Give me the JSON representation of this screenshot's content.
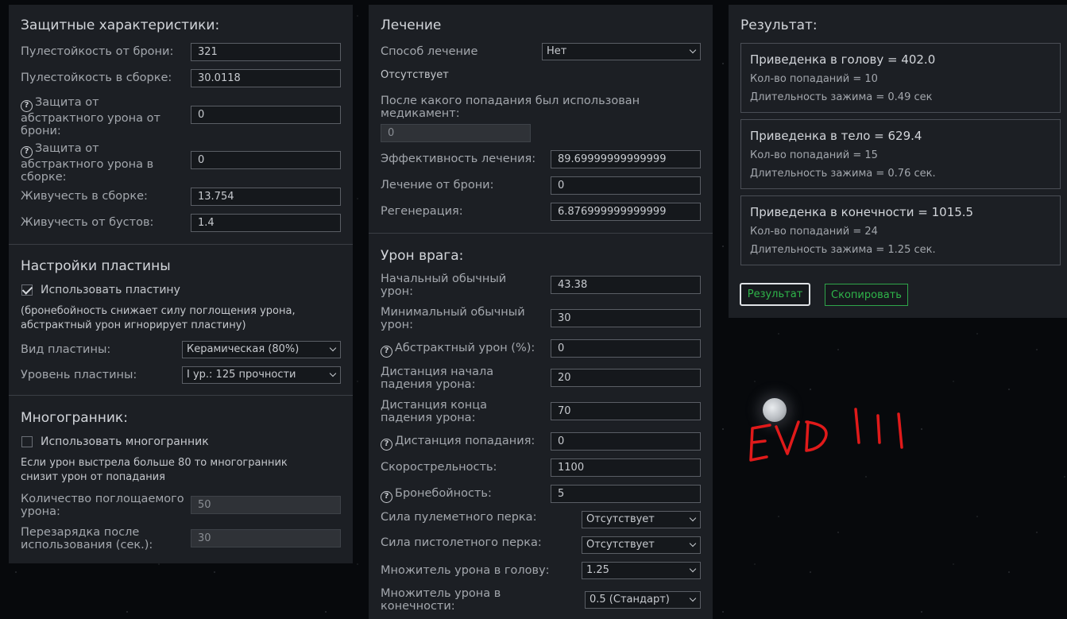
{
  "protective": {
    "title": "Защитные характеристики:",
    "armor_bullet_res_label": "Пулестойкость от брони:",
    "armor_bullet_res": "321",
    "build_bullet_res_label": "Пулестойкость в сборке:",
    "build_bullet_res": "30.0118",
    "armor_abstract_label": "Защита от абстрактного урона от брони:",
    "armor_abstract": "0",
    "build_abstract_label": "Защита от абстрактного урона в сборке:",
    "build_abstract": "0",
    "build_vitality_label": "Живучесть в сборке:",
    "build_vitality": "13.754",
    "boost_vitality_label": "Живучесть от бустов:",
    "boost_vitality": "1.4"
  },
  "plate": {
    "title": "Настройки пластины",
    "use_label": "Использовать пластину",
    "use_checked": true,
    "note": "(бронебойность снижает силу поглощения урона, абстрактный урон игнорирует пластину)",
    "type_label": "Вид пластины:",
    "type_value": "Керамическая (80%)",
    "level_label": "Уровень пластины:",
    "level_value": "I ур.: 125 прочности"
  },
  "poly": {
    "title": "Многогранник:",
    "use_label": "Использовать многогранник",
    "use_checked": false,
    "note": "Если урон выстрела больше 80 то многогранник снизит урон от попадания",
    "absorb_label": "Количество поглощаемого урона:",
    "absorb_value": "50",
    "cooldown_label": "Перезарядка после использования (сек.):",
    "cooldown_value": "30"
  },
  "healing": {
    "title": "Лечение",
    "method_label": "Способ лечение",
    "method_value": "Нет",
    "status": "Отсутствует",
    "after_hit_label": "После какого попадания был использован медикамент:",
    "after_hit_value": "0",
    "efficiency_label": "Эффективность лечения:",
    "efficiency_value": "89.69999999999999",
    "armor_heal_label": "Лечение от брони:",
    "armor_heal_value": "0",
    "regen_label": "Регенерация:",
    "regen_value": "6.876999999999999"
  },
  "enemy": {
    "title": "Урон врага:",
    "start_dmg_label": "Начальный обычный урон:",
    "start_dmg": "43.38",
    "min_dmg_label": "Минимальный обычный урон:",
    "min_dmg": "30",
    "abstract_label": "Абстрактный урон (%):",
    "abstract_value": "0",
    "falloff_start_label": "Дистанция начала падения урона:",
    "falloff_start": "20",
    "falloff_end_label": "Дистанция конца падения урона:",
    "falloff_end": "70",
    "hit_dist_label": "Дистанция попадания:",
    "hit_dist": "0",
    "rof_label": "Скорострельность:",
    "rof": "1100",
    "ap_label": "Бронебойность:",
    "ap": "5",
    "mg_perk_label": "Сила пулеметного перка:",
    "mg_perk": "Отсутствует",
    "pistol_perk_label": "Сила пистолетного перка:",
    "pistol_perk": "Отсутствует",
    "head_mult_label": "Множитель урона в голову:",
    "head_mult": "1.25",
    "limb_mult_label": "Множитель урона в конечности:",
    "limb_mult": "0.5 (Стандарт)"
  },
  "result": {
    "title": "Результат:",
    "head": {
      "title": "Приведенка в голову = 402.0",
      "hits": "Кол-во попаданий = 10",
      "hold": "Длительность зажима = 0.49 сек"
    },
    "body": {
      "title": "Приведенка в тело = 629.4",
      "hits": "Кол-во попаданий = 15",
      "hold": "Длительность зажима = 0.76 сек."
    },
    "limbs": {
      "title": "Приведенка в конечности = 1015.5",
      "hits": "Кол-во попаданий = 24",
      "hold": "Длительность зажима = 1.25 сек."
    },
    "result_button": "Результат",
    "copy_button": "Скопировать"
  },
  "graffiti": "EVD III",
  "colors": {
    "panel": "#1c1f24",
    "accent_green": "#2fb54a",
    "graffiti_red": "#e01a1a"
  }
}
